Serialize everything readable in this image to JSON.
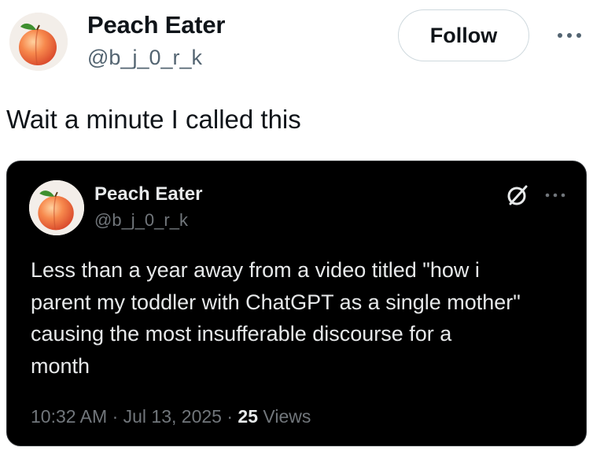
{
  "tweet": {
    "author_name": "Peach Eater",
    "author_handle": "@b_j_0_r_k",
    "avatar_icon": "peach-avatar",
    "follow_label": "Follow",
    "more_icon": "ellipsis-icon",
    "text": "Wait a minute I called this"
  },
  "quoted": {
    "author_name": "Peach Eater",
    "author_handle": "@b_j_0_r_k",
    "avatar_icon": "peach-avatar",
    "grok_icon": "grok-icon",
    "more_icon": "ellipsis-icon",
    "text": "Less than a year away from a video titled \"how i\nparent my toddler with ChatGPT as a single mother\"\ncausing the most insufferable discourse for a\nmonth",
    "time": "10:32 AM",
    "date": "Jul 13, 2025",
    "separator": "·",
    "views_count": "25",
    "views_label": "Views"
  },
  "colors": {
    "text_primary": "#0f1419",
    "text_secondary": "#536471",
    "card_bg": "#000000",
    "card_text": "#e7e9ea",
    "card_secondary": "#71767b"
  }
}
